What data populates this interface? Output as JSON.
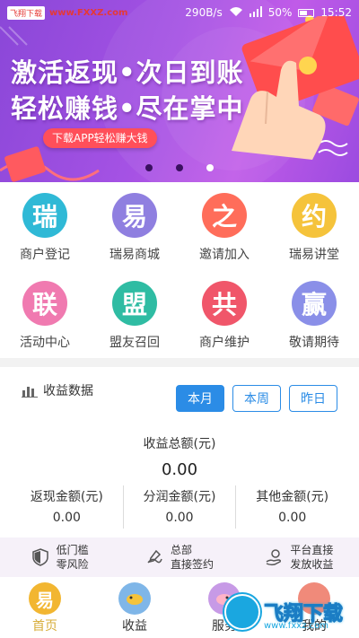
{
  "status_bar": {
    "watermark_tag": "飞翔下载",
    "watermark_url": "www.FXXZ.com",
    "speed": "290B/s",
    "battery": "50%",
    "time": "15:52"
  },
  "banner": {
    "title_line1": "激活返现•次日到账",
    "title_line2": "轻松赚钱•尽在掌中",
    "cta": "下载APP轻松赚大钱",
    "active_dot": 2
  },
  "grid": [
    {
      "name": "merchant-register",
      "glyph": "瑞",
      "label": "商户登记",
      "color": "#2fb9d6"
    },
    {
      "name": "ruiyi-mall",
      "glyph": "易",
      "label": "瑞易商城",
      "color": "#8f7fe0"
    },
    {
      "name": "invite-join",
      "glyph": "之",
      "label": "邀请加入",
      "color": "#ff6d5a"
    },
    {
      "name": "ruiyi-lecture",
      "glyph": "约",
      "label": "瑞易讲堂",
      "color": "#f5c33b"
    },
    {
      "name": "activity-center",
      "glyph": "联",
      "label": "活动中心",
      "color": "#f07ab0"
    },
    {
      "name": "ally-recall",
      "glyph": "盟",
      "label": "盟友召回",
      "color": "#2fbca3"
    },
    {
      "name": "merchant-maintain",
      "glyph": "共",
      "label": "商户维护",
      "color": "#f0566a"
    },
    {
      "name": "coming-soon",
      "glyph": "赢",
      "label": "敬请期待",
      "color": "#8a8fe8"
    }
  ],
  "income": {
    "title": "收益数据",
    "tabs": [
      "本月",
      "本周",
      "昨日"
    ],
    "active_tab": 0,
    "total_label": "收益总额(元)",
    "total_value": "0.00",
    "metrics": [
      {
        "label": "返现金额(元)",
        "value": "0.00"
      },
      {
        "label": "分润金额(元)",
        "value": "0.00"
      },
      {
        "label": "其他金额(元)",
        "value": "0.00"
      }
    ]
  },
  "features": [
    {
      "line1": "低门槛",
      "line2": "零风险"
    },
    {
      "line1": "总部",
      "line2": "直接签约"
    },
    {
      "line1": "平台直接",
      "line2": "发放收益"
    }
  ],
  "nav": [
    {
      "label": "首页",
      "glyph": "易",
      "color": "#f2b631"
    },
    {
      "label": "收益",
      "glyph": "",
      "color": "#7fb6e8"
    },
    {
      "label": "服务",
      "glyph": "",
      "color": "#c79ae6"
    },
    {
      "label": "我的",
      "glyph": "",
      "color": "#f08a7a"
    }
  ],
  "watermark_badge": {
    "text": "飞翔下载",
    "sub": "www.fxxz.com"
  }
}
